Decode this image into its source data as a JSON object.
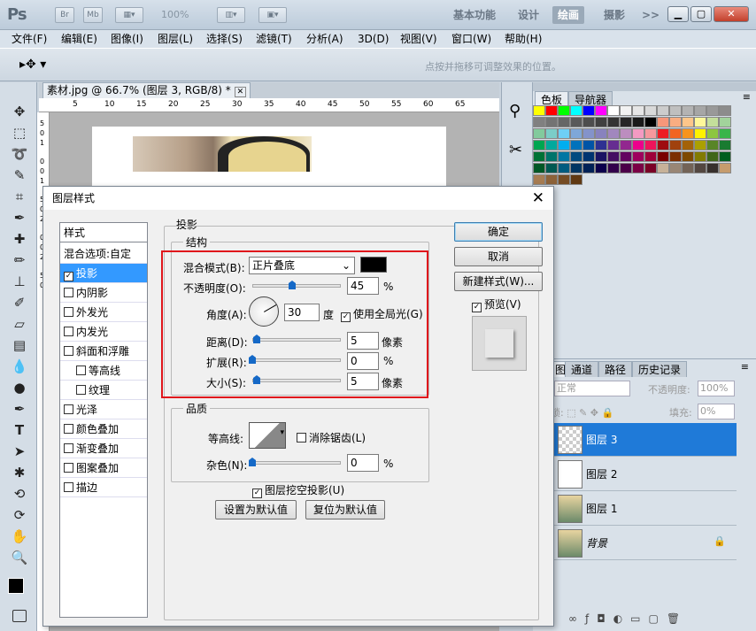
{
  "app": {
    "logo": "Ps",
    "btn_br": "Br",
    "btn_mb": "Mb",
    "zoom": "100%"
  },
  "workspaces": [
    "基本功能",
    "设计",
    "绘画",
    "摄影",
    ">>"
  ],
  "menu": [
    "文件(F)",
    "编辑(E)",
    "图像(I)",
    "图层(L)",
    "选择(S)",
    "滤镜(T)",
    "分析(A)",
    "3D(D)",
    "视图(V)",
    "窗口(W)",
    "帮助(H)"
  ],
  "options": {
    "hint": "点按并拖移可调整效果的位置。"
  },
  "document": {
    "tab": "素材.jpg @ 66.7% (图层 3, RGB/8) *",
    "ruler": [
      "5",
      "10",
      "15",
      "20",
      "25",
      "30",
      "35",
      "40",
      "45",
      "50",
      "55",
      "60",
      "65"
    ],
    "vruler": [
      "5",
      "0",
      "1",
      "0",
      "0",
      "1",
      "5",
      "0",
      "2",
      "0",
      "0",
      "2",
      "5",
      "0"
    ]
  },
  "panels": {
    "color_tab": "色板",
    "nav_tab": "导航器",
    "layers_tabs": [
      "图层",
      "通道",
      "路径",
      "历史记录"
    ],
    "blend": "正常",
    "opacity_label": "不透明度:",
    "opacity": "100%",
    "lock_label": "锁定:",
    "fill_label": "填充:",
    "fill": "0%",
    "layers": [
      {
        "name": "图层 3"
      },
      {
        "name": "图层 2"
      },
      {
        "name": "图层 1"
      },
      {
        "name": "背景"
      }
    ]
  },
  "swatch_colors": [
    "#ffff00",
    "#ff0000",
    "#00ff00",
    "#00ffff",
    "#0000ff",
    "#ff00ff",
    "#ffffff",
    "#f2f2f2",
    "#e6e6e6",
    "#d9d9d9",
    "#cccccc",
    "#bfbfbf",
    "#b3b3b3",
    "#a6a6a6",
    "#999999",
    "#8c8c8c",
    "#808080",
    "#737373",
    "#666666",
    "#595959",
    "#4d4d4d",
    "#404040",
    "#333333",
    "#262626",
    "#1a1a1a",
    "#000000",
    "#f7977a",
    "#f9ad81",
    "#fdc68a",
    "#fff79a",
    "#c4df9b",
    "#a2d39c",
    "#82ca9d",
    "#7bcdc8",
    "#6ecff6",
    "#7ea7d8",
    "#8493ca",
    "#8882be",
    "#a187be",
    "#bc8dbf",
    "#f49ac2",
    "#f6989d",
    "#ed1c24",
    "#f26522",
    "#f7941d",
    "#fff200",
    "#8dc63f",
    "#39b54a",
    "#00a651",
    "#00a99d",
    "#00aeef",
    "#0072bc",
    "#0054a6",
    "#2e3192",
    "#662d91",
    "#92278f",
    "#ec008c",
    "#ed145b",
    "#9e0b0f",
    "#a0410d",
    "#a36209",
    "#aba000",
    "#598527",
    "#1a7b30",
    "#007236",
    "#00746b",
    "#0076a3",
    "#004a80",
    "#003471",
    "#1b1464",
    "#440e62",
    "#630460",
    "#9e005d",
    "#9e0039",
    "#790000",
    "#7b2e00",
    "#7d4900",
    "#827b00",
    "#406618",
    "#005e20",
    "#005826",
    "#005952",
    "#005b7f",
    "#003663",
    "#002157",
    "#0d004c",
    "#32004b",
    "#4b0049",
    "#7b0046",
    "#7a0026",
    "#c7b299",
    "#998675",
    "#736357",
    "#534741",
    "#37302d",
    "#c69c6d",
    "#a67c52",
    "#8c6239",
    "#754c24",
    "#603913"
  ],
  "dialog": {
    "title": "图层样式",
    "close": "✕",
    "styles_header": "样式",
    "blend_options": "混合选项:自定",
    "style_items": [
      {
        "label": "投影",
        "checked": true,
        "sel": true
      },
      {
        "label": "内阴影"
      },
      {
        "label": "外发光"
      },
      {
        "label": "内发光"
      },
      {
        "label": "斜面和浮雕"
      },
      {
        "label": "等高线",
        "indent": true
      },
      {
        "label": "纹理",
        "indent": true
      },
      {
        "label": "光泽"
      },
      {
        "label": "颜色叠加"
      },
      {
        "label": "渐变叠加"
      },
      {
        "label": "图案叠加"
      },
      {
        "label": "描边"
      }
    ],
    "section": "投影",
    "structure": "结构",
    "blend_mode_label": "混合模式(B):",
    "blend_mode": "正片叠底",
    "opacity_label": "不透明度(O):",
    "opacity": "45",
    "opacity_level": 0.45,
    "pct": "%",
    "angle_label": "角度(A):",
    "angle": "30",
    "degree": "度",
    "global_light": "使用全局光(G)",
    "distance_label": "距离(D):",
    "distance": "5",
    "distance_level": 0.05,
    "px": "像素",
    "spread_label": "扩展(R):",
    "spread": "0",
    "spread_level": 0,
    "size_label": "大小(S):",
    "size": "5",
    "size_level": 0.05,
    "quality": "品质",
    "contour_label": "等高线:",
    "antialias": "消除锯齿(L)",
    "noise_label": "杂色(N):",
    "noise": "0",
    "noise_level": 0,
    "knockout": "图层挖空投影(U)",
    "set_default": "设置为默认值",
    "reset_default": "复位为默认值",
    "ok": "确定",
    "cancel": "取消",
    "new_style": "新建样式(W)...",
    "preview": "预览(V)"
  }
}
